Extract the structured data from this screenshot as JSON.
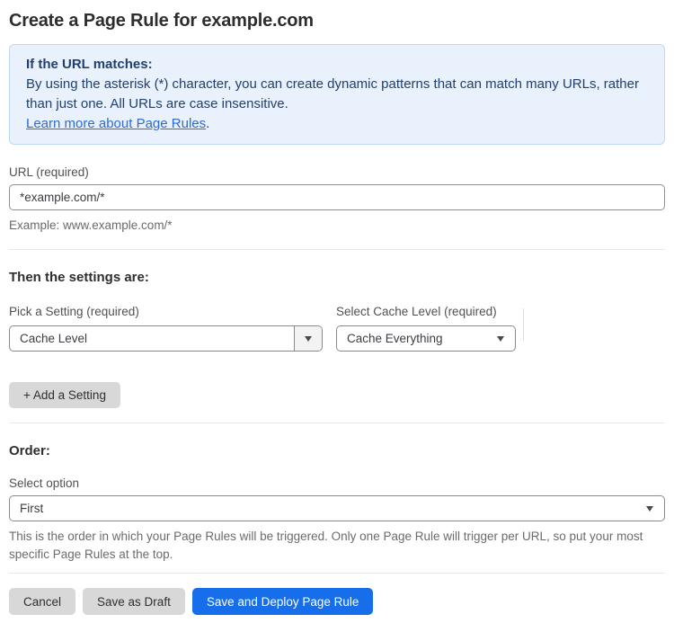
{
  "page": {
    "title": "Create a Page Rule for example.com"
  },
  "info_box": {
    "heading": "If the URL matches:",
    "body": "By using the asterisk (*) character, you can create dynamic patterns that can match many URLs, rather than just one. All URLs are case insensitive.",
    "link_label": "Learn more about Page Rules",
    "link_suffix": "."
  },
  "url_field": {
    "label": "URL (required)",
    "value": "*example.com/*",
    "helper": "Example: www.example.com/*"
  },
  "settings": {
    "heading": "Then the settings are:",
    "setting_label": "Pick a Setting (required)",
    "setting_selected": "Cache Level",
    "value_label": "Select Cache Level (required)",
    "value_selected": "Cache Everything",
    "add_button_label": "+ Add a Setting"
  },
  "order": {
    "heading": "Order:",
    "label": "Select option",
    "selected": "First",
    "helper": "This is the order in which your Page Rules will be triggered. Only one Page Rule will trigger per URL, so put your most specific Page Rules at the top."
  },
  "footer": {
    "cancel_label": "Cancel",
    "save_draft_label": "Save as Draft",
    "save_deploy_label": "Save and Deploy Page Rule"
  },
  "colors": {
    "info_box_background": "#e8f1fc",
    "info_box_border": "#bfd8f3",
    "info_box_text": "#21406f",
    "link_blue": "#2e6bd8",
    "primary_button_blue": "#176eeb",
    "gray_button": "#d8d8d8"
  }
}
